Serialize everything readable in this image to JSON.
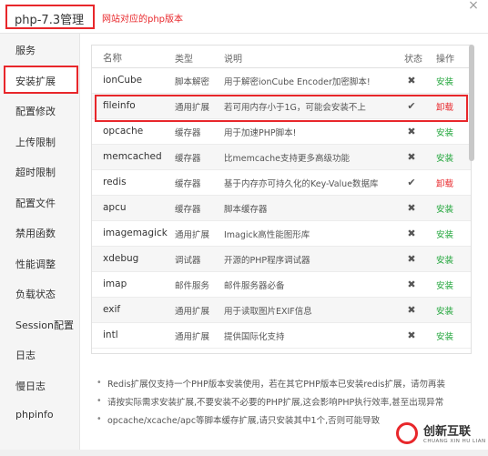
{
  "window": {
    "title": "php-7.3管理",
    "annotation": "网站对应的php版本",
    "close": "×"
  },
  "sidebar": {
    "items": [
      {
        "label": "服务",
        "active": false
      },
      {
        "label": "安装扩展",
        "active": true
      },
      {
        "label": "配置修改",
        "active": false
      },
      {
        "label": "上传限制",
        "active": false
      },
      {
        "label": "超时限制",
        "active": false
      },
      {
        "label": "配置文件",
        "active": false
      },
      {
        "label": "禁用函数",
        "active": false
      },
      {
        "label": "性能调整",
        "active": false
      },
      {
        "label": "负载状态",
        "active": false
      },
      {
        "label": "Session配置",
        "active": false
      },
      {
        "label": "日志",
        "active": false
      },
      {
        "label": "慢日志",
        "active": false
      },
      {
        "label": "phpinfo",
        "active": false
      }
    ]
  },
  "table": {
    "headers": {
      "name": "名称",
      "type": "类型",
      "desc": "说明",
      "state": "状态",
      "op": "操作"
    },
    "rows": [
      {
        "name": "ionCube",
        "type": "脚本解密",
        "desc": "用于解密ionCube Encoder加密脚本!",
        "state": "✖",
        "op": "安装",
        "installed": false
      },
      {
        "name": "fileinfo",
        "type": "通用扩展",
        "desc": "若可用内存小于1G，可能会安装不上",
        "state": "✔",
        "op": "卸载",
        "installed": true
      },
      {
        "name": "opcache",
        "type": "缓存器",
        "desc": "用于加速PHP脚本!",
        "state": "✖",
        "op": "安装",
        "installed": false
      },
      {
        "name": "memcached",
        "type": "缓存器",
        "desc": "比memcache支持更多高级功能",
        "state": "✖",
        "op": "安装",
        "installed": false
      },
      {
        "name": "redis",
        "type": "缓存器",
        "desc": "基于内存亦可持久化的Key-Value数据库",
        "state": "✔",
        "op": "卸载",
        "installed": true
      },
      {
        "name": "apcu",
        "type": "缓存器",
        "desc": "脚本缓存器",
        "state": "✖",
        "op": "安装",
        "installed": false
      },
      {
        "name": "imagemagick",
        "type": "通用扩展",
        "desc": "Imagick高性能图形库",
        "state": "✖",
        "op": "安装",
        "installed": false
      },
      {
        "name": "xdebug",
        "type": "调试器",
        "desc": "开源的PHP程序调试器",
        "state": "✖",
        "op": "安装",
        "installed": false
      },
      {
        "name": "imap",
        "type": "邮件服务",
        "desc": "邮件服务器必备",
        "state": "✖",
        "op": "安装",
        "installed": false
      },
      {
        "name": "exif",
        "type": "通用扩展",
        "desc": "用于读取图片EXIF信息",
        "state": "✖",
        "op": "安装",
        "installed": false
      },
      {
        "name": "intl",
        "type": "通用扩展",
        "desc": "提供国际化支持",
        "state": "✖",
        "op": "安装",
        "installed": false
      }
    ]
  },
  "notes": [
    "Redis扩展仅支持一个PHP版本安装使用，若在其它PHP版本已安装redis扩展，请勿再装",
    "请按实际需求安装扩展,不要安装不必要的PHP扩展,这会影响PHP执行效率,甚至出现异常",
    "opcache/xcache/apc等脚本缓存扩展,请只安装其中1个,否则可能导致"
  ],
  "watermark": {
    "text": "创新互联",
    "sub": "CHUANG XIN HU LIAN"
  },
  "colors": {
    "accent_red": "#e8272b",
    "install_green": "#20a53a"
  }
}
